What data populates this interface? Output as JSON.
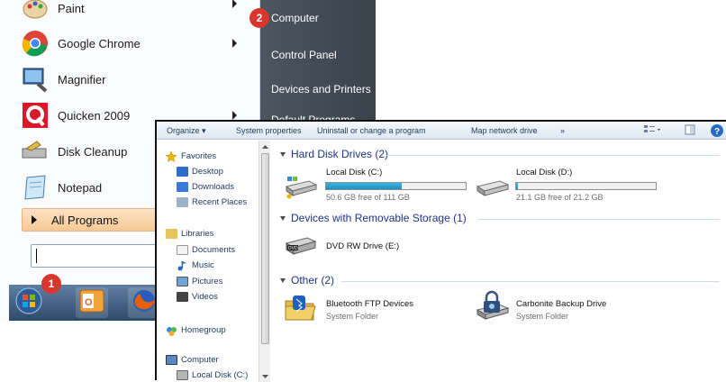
{
  "start_menu": {
    "programs": [
      {
        "label": "Paint",
        "icon": "paint-palette-icon",
        "has_submenu": true
      },
      {
        "label": "Google Chrome",
        "icon": "chrome-icon",
        "has_submenu": true
      },
      {
        "label": "Magnifier",
        "icon": "magnifier-icon",
        "has_submenu": false
      },
      {
        "label": "Quicken 2009",
        "icon": "quicken-icon",
        "has_submenu": true
      },
      {
        "label": "Disk Cleanup",
        "icon": "disk-cleanup-icon",
        "has_submenu": false
      },
      {
        "label": "Notepad",
        "icon": "notepad-icon",
        "has_submenu": false
      }
    ],
    "all_programs": "All Programs",
    "search_value": "",
    "right_items": [
      "Computer",
      "Control Panel",
      "Devices and Printers",
      "Default Programs"
    ]
  },
  "badges": {
    "start": "1",
    "computer": "2"
  },
  "taskbar": {
    "items": [
      "start-orb-icon",
      "outlook-icon",
      "firefox-icon"
    ]
  },
  "explorer": {
    "toolbar": {
      "organize": "Organize ▾",
      "system_properties": "System properties",
      "uninstall": "Uninstall or change a program",
      "map_drive": "Map network drive",
      "more": "»"
    },
    "nav": {
      "favorites": "Favorites",
      "desktop": "Desktop",
      "downloads": "Downloads",
      "recent": "Recent Places",
      "libraries": "Libraries",
      "documents": "Documents",
      "music": "Music",
      "pictures": "Pictures",
      "videos": "Videos",
      "homegroup": "Homegroup",
      "computer": "Computer",
      "local_c": "Local Disk (C:)"
    },
    "groups": {
      "hdd": "Hard Disk Drives (2)",
      "removable": "Devices with Removable Storage (1)",
      "other": "Other (2)"
    },
    "drives": [
      {
        "name": "Local Disk (C:)",
        "free": "50.6 GB free of 111 GB",
        "used_fraction": 0.54
      },
      {
        "name": "Local Disk (D:)",
        "free": "21.1 GB free of 21.2 GB",
        "used_fraction": 0.01
      }
    ],
    "dvd": {
      "name": "DVD RW Drive (E:)"
    },
    "others": [
      {
        "name": "Bluetooth FTP Devices",
        "sub": "System Folder"
      },
      {
        "name": "Carbonite Backup Drive",
        "sub": "System Folder"
      }
    ]
  },
  "colors": {
    "accent_blue": "#1e3287",
    "badge_red": "#d9372e",
    "start_right_bg": "#3a424c"
  }
}
